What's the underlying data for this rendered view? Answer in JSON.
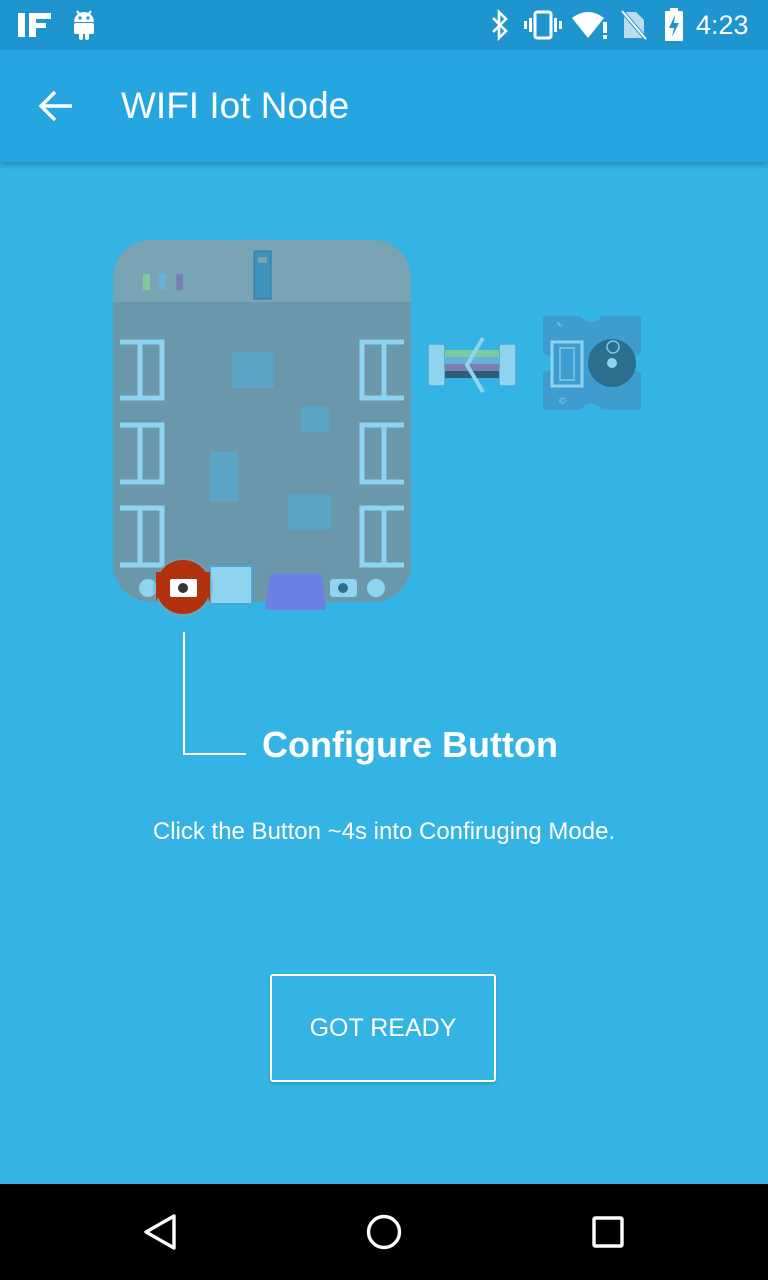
{
  "status_bar": {
    "time": "4:23",
    "left_icons": [
      "ifttt-icon",
      "android-icon"
    ],
    "right_icons": [
      "bluetooth-icon",
      "vibrate-icon",
      "wifi-icon",
      "no-sim-icon",
      "battery-charging-icon"
    ]
  },
  "app_bar": {
    "title": "WIFI Iot Node",
    "back_icon": "arrow-back-icon"
  },
  "main": {
    "illustration": {
      "description_icon": "iot-board-illustration",
      "board_color": "#6a97a9",
      "highlight_color": "#b0310b"
    },
    "configure_label": "Configure Button",
    "instruction": "Click the Button ~4s into Confiruging Mode.",
    "got_ready_label": "GOT READY"
  },
  "nav_bar": {
    "icons": [
      "back-triangle-icon",
      "home-circle-icon",
      "recents-square-icon"
    ]
  },
  "colors": {
    "status_bar": "#1f95d0",
    "app_bar": "#25a6e0",
    "background": "#34b4e4",
    "nav_bar": "#000000"
  }
}
